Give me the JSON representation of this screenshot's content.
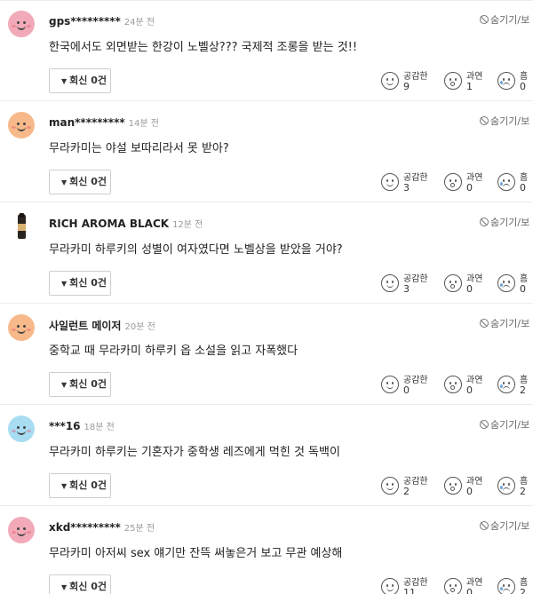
{
  "hide_label": "숨기기/보",
  "reply_label": "회신 0건",
  "reactions": {
    "empathy": "공감한",
    "excessive": "과연",
    "sad": "흠"
  },
  "comments": [
    {
      "nick": "gps*********",
      "time": "24분 전",
      "text": "한국에서도 외면받는 한강이 노벨상??? 국제적 조롱을 받는 것!!",
      "empathy": "9",
      "excessive": "1",
      "sad": "0",
      "avatar": "pink"
    },
    {
      "nick": "man*********",
      "time": "14분 전",
      "text": "무라카미는 야설 보따리라서 못 받아?",
      "empathy": "3",
      "excessive": "0",
      "sad": "0",
      "avatar": "orange"
    },
    {
      "nick": "RICH AROMA BLACK",
      "time": "12분 전",
      "text": "무라카미 하루키의 성별이 여자였다면 노벨상을 받았을 거야?",
      "empathy": "3",
      "excessive": "0",
      "sad": "0",
      "avatar": "bottle"
    },
    {
      "nick": "사일런트 메이저",
      "time": "20분 전",
      "text": "중학교 때 무라카미 하루키 옵 소설을 읽고 자폭했다",
      "empathy": "0",
      "excessive": "0",
      "sad": "2",
      "avatar": "orange"
    },
    {
      "nick": "***16",
      "time": "18분 전",
      "text": "무라카미 하루키는 기혼자가 중학생 레즈에게 먹힌 것 독백이",
      "empathy": "2",
      "excessive": "0",
      "sad": "2",
      "avatar": "blue"
    },
    {
      "nick": "xkd*********",
      "time": "25분 전",
      "text": "무라카미 아저씨 sex 얘기만 잔뜩 써놓은거 보고 무관 예상해",
      "empathy": "11",
      "excessive": "0",
      "sad": "2",
      "avatar": "pink"
    }
  ]
}
